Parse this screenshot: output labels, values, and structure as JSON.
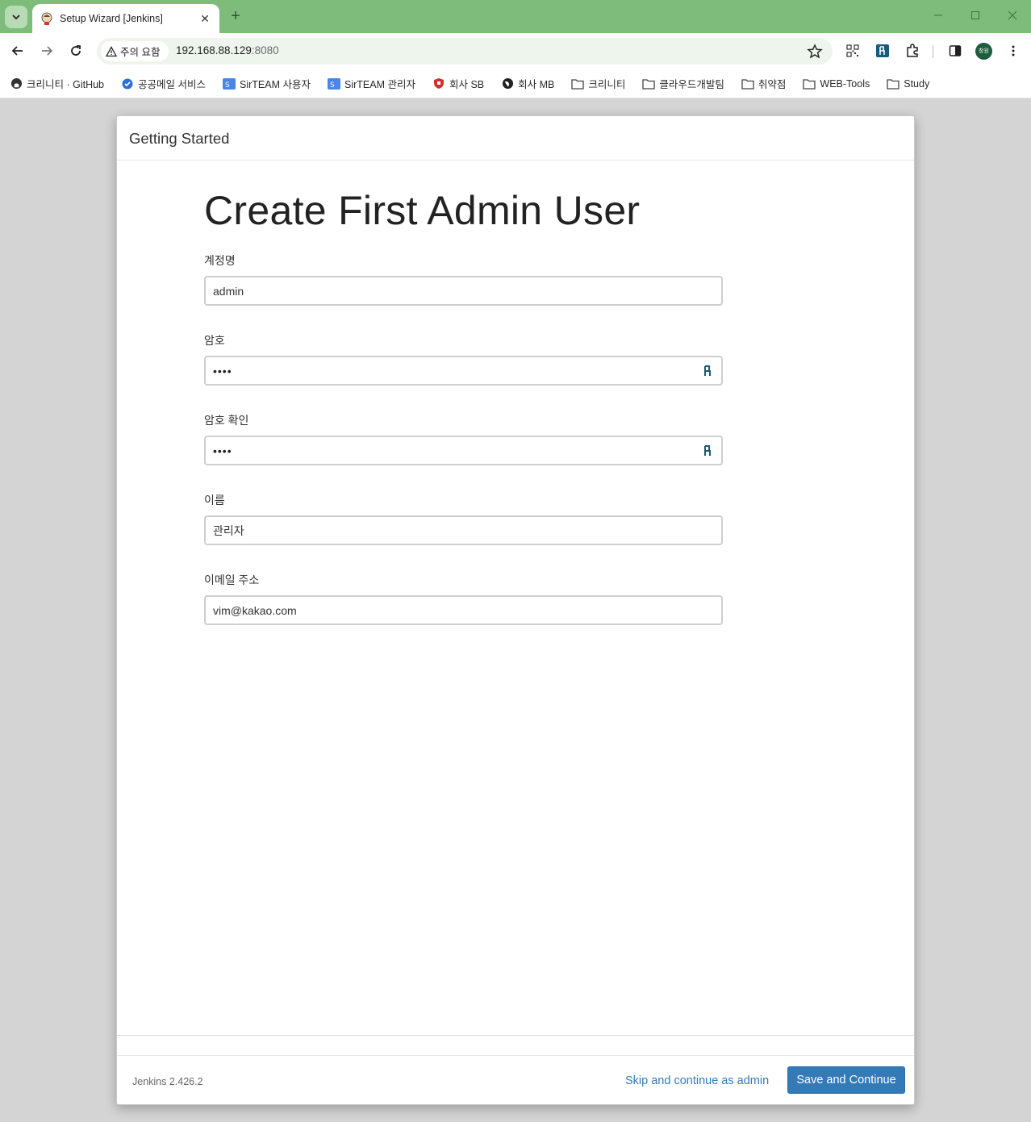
{
  "browser": {
    "tab_title": "Setup Wizard [Jenkins]",
    "tab_close": "✕",
    "new_tab": "+",
    "security_chip": "주의 요함",
    "url_host": "192.168.88.129",
    "url_port": ":8080",
    "avatar_text": "창원",
    "accent_color": "#7dbc7b",
    "bookmarks": [
      {
        "label": "크리니티 · GitHub",
        "icon": "github-icon"
      },
      {
        "label": "공공메일 서비스",
        "icon": "verified-badge-icon"
      },
      {
        "label": "SirTEAM 사용자",
        "icon": "sirteam-icon"
      },
      {
        "label": "SirTEAM 관리자",
        "icon": "sirteam-icon"
      },
      {
        "label": "회사 SB",
        "icon": "shield-icon"
      },
      {
        "label": "회사 MB",
        "icon": "globe-icon"
      },
      {
        "label": "크리니티",
        "icon": "folder-icon"
      },
      {
        "label": "클라우드개발팀",
        "icon": "folder-icon"
      },
      {
        "label": "취약점",
        "icon": "folder-icon"
      },
      {
        "label": "WEB-Tools",
        "icon": "folder-icon"
      },
      {
        "label": "Study",
        "icon": "folder-icon"
      }
    ]
  },
  "dialog": {
    "header_title": "Getting Started",
    "page_title": "Create First Admin User",
    "fields": {
      "username": {
        "label": "계정명",
        "value": "admin"
      },
      "password": {
        "label": "암호",
        "value": "••••"
      },
      "password_confirm": {
        "label": "암호 확인",
        "value": "••••"
      },
      "fullname": {
        "label": "이름",
        "value": "관리자"
      },
      "email": {
        "label": "이메일 주소",
        "value": "vim@kakao.com"
      }
    },
    "footer": {
      "version": "Jenkins 2.426.2",
      "skip_label": "Skip and continue as admin",
      "save_label": "Save and Continue",
      "primary_color": "#337ab7"
    }
  }
}
